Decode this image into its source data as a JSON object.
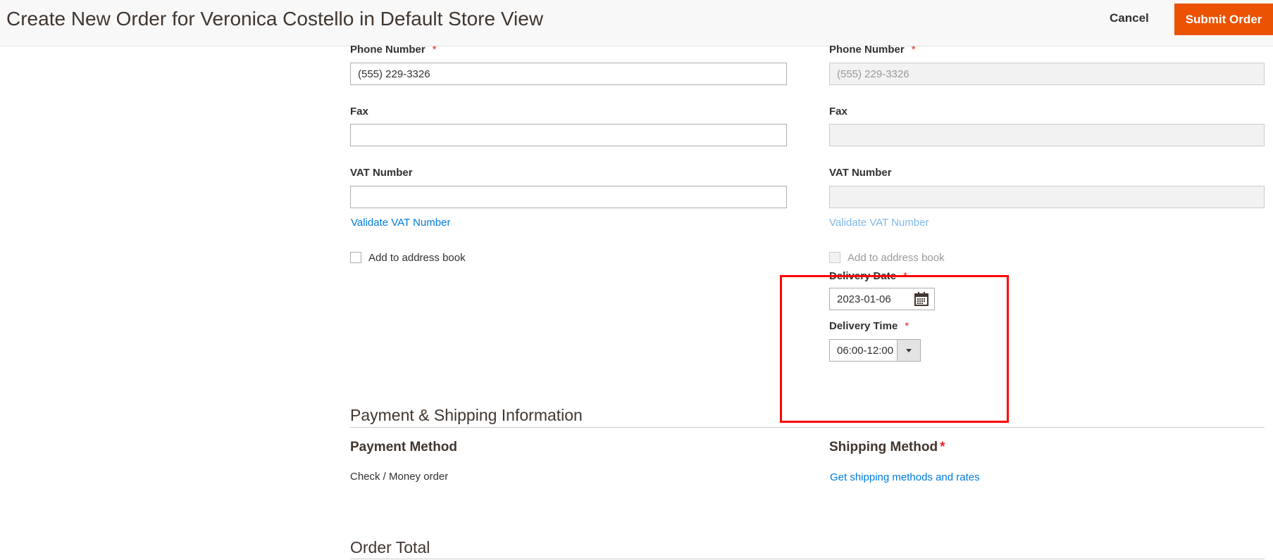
{
  "header": {
    "title": "Create New Order for Veronica Costello in Default Store View",
    "cancel_label": "Cancel",
    "submit_label": "Submit Order"
  },
  "billing": {
    "phone_label": "Phone Number",
    "phone_value": "(555) 229-3326",
    "fax_label": "Fax",
    "fax_value": "",
    "vat_label": "VAT Number",
    "vat_value": "",
    "validate_vat": "Validate VAT Number",
    "add_to_address_book": "Add to address book"
  },
  "shipping": {
    "phone_label": "Phone Number",
    "phone_value": "(555) 229-3326",
    "fax_label": "Fax",
    "fax_value": "",
    "vat_label": "VAT Number",
    "vat_value": "",
    "validate_vat": "Validate VAT Number",
    "add_to_address_book": "Add to address book",
    "delivery_date_label": "Delivery Date",
    "delivery_date_value": "2023-01-06",
    "delivery_time_label": "Delivery Time",
    "delivery_time_value": "06:00-12:00"
  },
  "required_mark": "*",
  "payment_shipping": {
    "heading": "Payment & Shipping Information",
    "payment_method_label": "Payment Method",
    "payment_method_value": "Check / Money order",
    "shipping_method_label": "Shipping Method",
    "shipping_link": "Get shipping methods and rates"
  },
  "order_total": {
    "heading": "Order Total"
  },
  "colors": {
    "accent": "#eb5202",
    "link": "#007bdb",
    "required": "#e22626",
    "highlight_box": "#ff0000"
  }
}
